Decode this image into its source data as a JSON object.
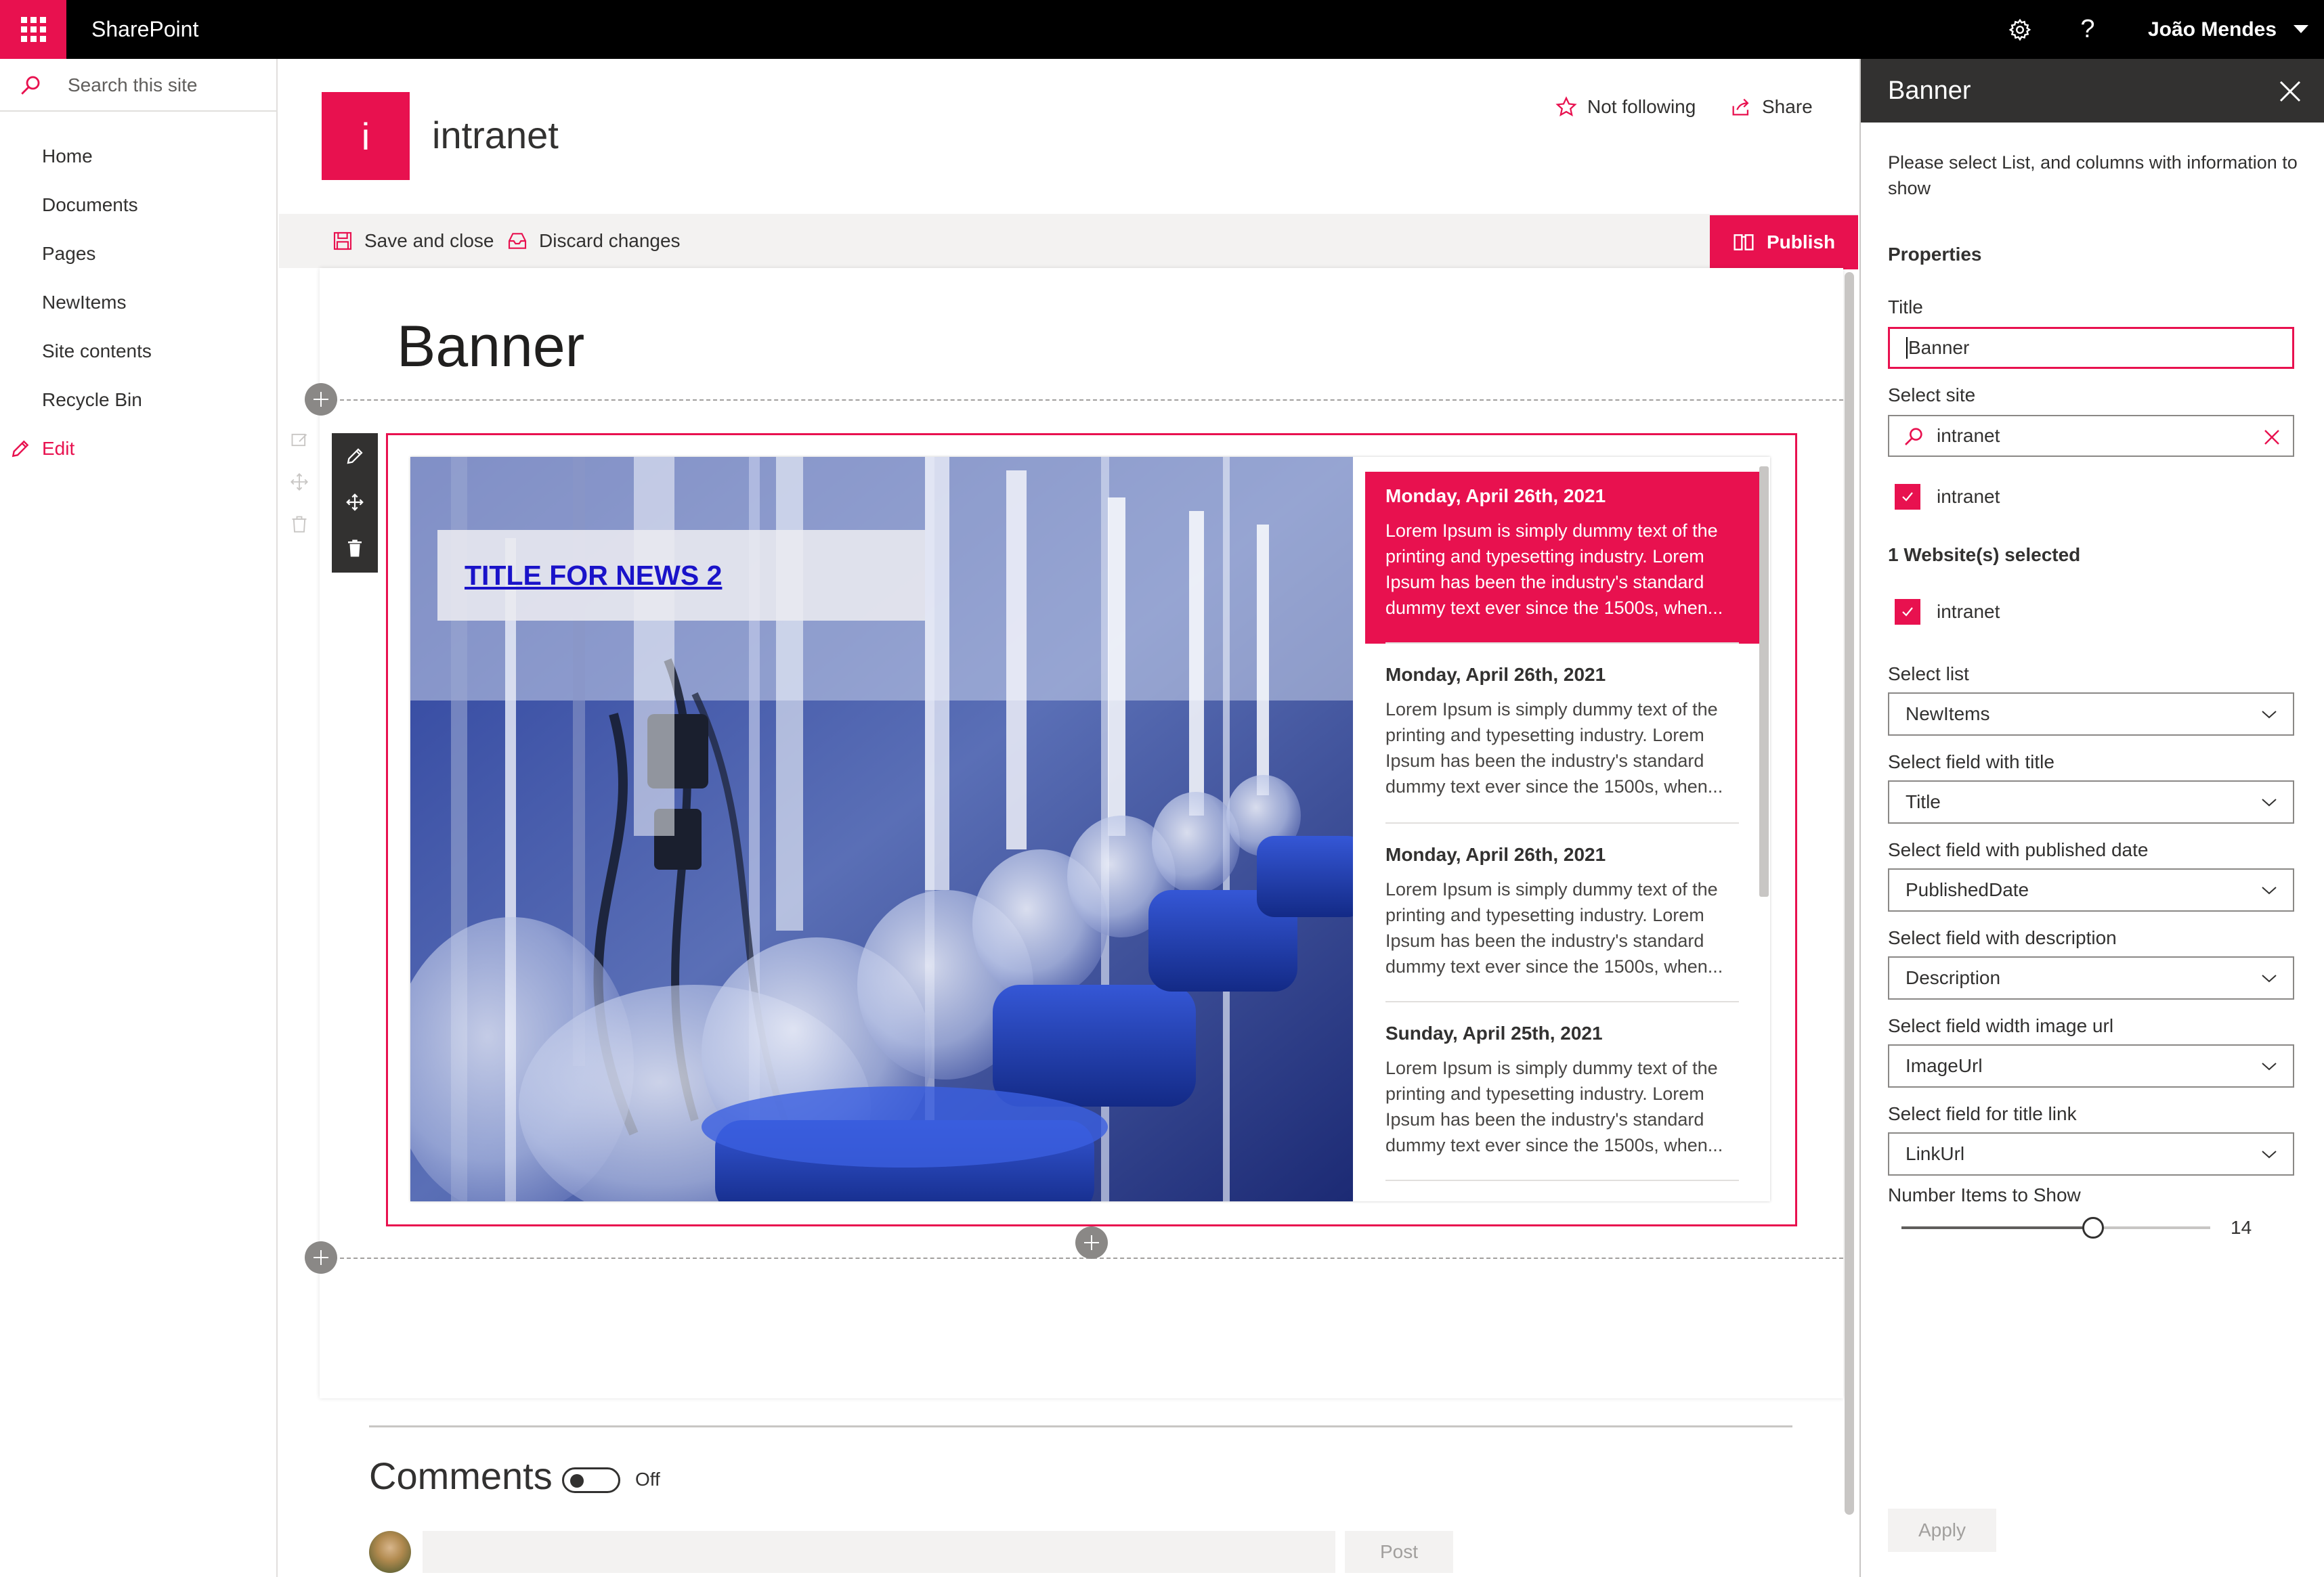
{
  "suite_bar": {
    "brand": "SharePoint",
    "user_name": "João Mendes",
    "icons": [
      "waffle-icon",
      "gear-icon",
      "help-icon",
      "caret-down-icon"
    ]
  },
  "left_nav": {
    "search_placeholder": "Search this site",
    "items": [
      {
        "label": "Home"
      },
      {
        "label": "Documents"
      },
      {
        "label": "Pages"
      },
      {
        "label": "NewItems"
      },
      {
        "label": "Site contents"
      },
      {
        "label": "Recycle Bin"
      }
    ],
    "edit_label": "Edit"
  },
  "site_header": {
    "logo_letter": "i",
    "title": "intranet",
    "follow_label": "Not following",
    "share_label": "Share"
  },
  "command_bar": {
    "save_close_label": "Save and close",
    "discard_label": "Discard changes",
    "publish_label": "Publish"
  },
  "page": {
    "title": "Banner"
  },
  "banner": {
    "hero_title": "TITLE FOR NEWS 2",
    "news": [
      {
        "date": "Monday, April 26th, 2021",
        "description": "Lorem Ipsum is simply dummy text of the printing and typesetting industry. Lorem Ipsum has been the industry's standard dummy text ever since the 1500s, when...",
        "active": true
      },
      {
        "date": "Monday, April 26th, 2021",
        "description": "Lorem Ipsum is simply dummy text of the printing and typesetting industry. Lorem Ipsum has been the industry's standard dummy text ever since the 1500s, when...",
        "active": false
      },
      {
        "date": "Monday, April 26th, 2021",
        "description": "Lorem Ipsum is simply dummy text of the printing and typesetting industry. Lorem Ipsum has been the industry's standard dummy text ever since the 1500s, when...",
        "active": false
      },
      {
        "date": "Sunday, April 25th, 2021",
        "description": "Lorem Ipsum is simply dummy text of the printing and typesetting industry. Lorem Ipsum has been the industry's standard dummy text ever since the 1500s, when...",
        "active": false
      }
    ]
  },
  "comments": {
    "title": "Comments",
    "toggle_label": "Off",
    "toggle_on": false,
    "post_label": "Post"
  },
  "property_pane": {
    "title": "Banner",
    "intro": "Please select List, and columns with information to show",
    "properties_heading": "Properties",
    "title_label": "Title",
    "title_value": "Banner",
    "select_site_label": "Select site",
    "site_search_value": "intranet",
    "site_option_label": "intranet",
    "site_option_checked": true,
    "selected_count_label": "1 Website(s) selected",
    "selected_site_label": "intranet",
    "selected_site_checked": true,
    "select_list_label": "Select list",
    "select_list_value": "NewItems",
    "field_title_label": "Select field with title",
    "field_title_value": "Title",
    "field_date_label": "Select field with published date",
    "field_date_value": "PublishedDate",
    "field_desc_label": "Select field with description",
    "field_desc_value": "Description",
    "field_image_label": "Select field width image url",
    "field_image_value": "ImageUrl",
    "field_link_label": "Select field for title link",
    "field_link_value": "LinkUrl",
    "number_items_label": "Number Items to Show",
    "number_items_value": "14",
    "number_items_fraction": 0.62,
    "apply_label": "Apply"
  },
  "colors": {
    "accent": "#e8114f",
    "suite_bar": "#000000",
    "pane_header": "#323130",
    "link": "#1a13c9"
  }
}
